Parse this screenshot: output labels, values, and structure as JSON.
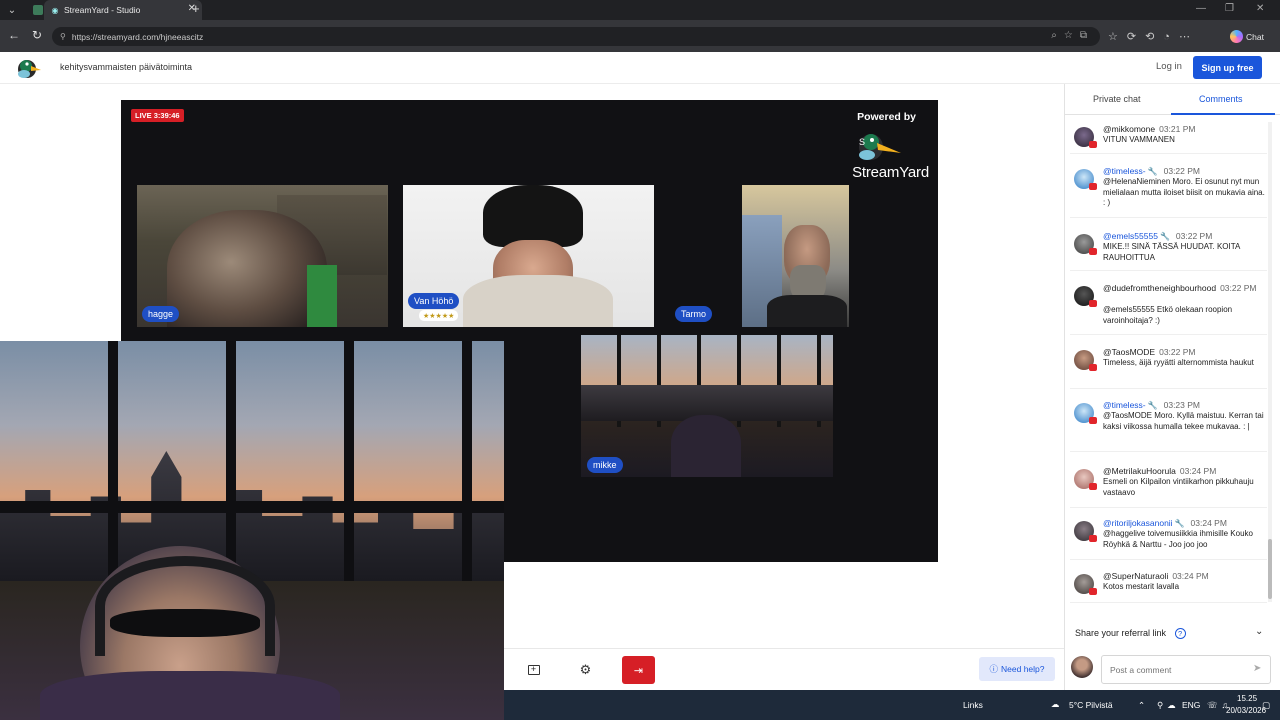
{
  "browser": {
    "tab_title": "StreamYard - Studio",
    "tab_close": "✕",
    "new_tab": "+",
    "url": "https://streamyard.com/hjneeascitz",
    "chat_label": "Chat",
    "window_controls": [
      "—",
      "❐",
      "✕"
    ]
  },
  "header": {
    "studio_title": "kehitysvammaisten päivätoiminta",
    "login_label": "Log in",
    "signup_label": "Sign up free"
  },
  "stage": {
    "live_badge": "LIVE 3:39:46",
    "powered_by": "Powered by",
    "brand": "StreamYard",
    "participants": [
      {
        "name": "hagge"
      },
      {
        "name": "Van Höhö",
        "stars": "★★★★★"
      },
      {
        "name": "Tarmo"
      },
      {
        "name": "mikke"
      }
    ]
  },
  "controls": {
    "need_help": "Need help?",
    "buttons": [
      "add-source",
      "settings",
      "leave"
    ]
  },
  "panel": {
    "tabs": [
      "Private chat",
      "Comments"
    ],
    "active_tab": "Comments",
    "comments": [
      {
        "name": "@mikkomone",
        "time": "03:21 PM",
        "text": "VITUN VAMMANEN",
        "mod": false
      },
      {
        "name": "@timeless-",
        "time": "03:22 PM",
        "text": "@HelenaNieminen Moro. Ei osunut nyt mun mielialaan mutta iloiset biisit on mukavia aina. : )",
        "mod": true
      },
      {
        "name": "@emels55555",
        "time": "03:22 PM",
        "text": "MIKE.!! SINÄ TÄSSÄ HUUDAT. KOITA RAUHOITTUA",
        "mod": true
      },
      {
        "name": "@dudefromtheneighbourhood",
        "time": "03:22 PM",
        "text": "@emels55555 Etkö olekaan roopion varoinhoitaja? :)",
        "mod": false
      },
      {
        "name": "@TaosMODE",
        "time": "03:22 PM",
        "text": "Timeless, äijä ryyätti alternommista haukut",
        "mod": false
      },
      {
        "name": "@timeless-",
        "time": "03:23 PM",
        "text": "@TaosMODE Moro. Kyllä maistuu. Kerran tai kaksi viikossa humalla tekee mukavaa. : |",
        "mod": true
      },
      {
        "name": "@MetrilakuHoorula",
        "time": "03:24 PM",
        "text": "Esmeli on Kilpailon vintiikarhon pikkuhauju vastaavo",
        "mod": false
      },
      {
        "name": "@ritoriljokasanonii",
        "time": "03:24 PM",
        "text": "@haggelive toivemusiikkia ihmisille Kouko Röyhkä & Narttu - Joo joo joo",
        "mod": true
      },
      {
        "name": "@SuperNaturaoli",
        "time": "03:24 PM",
        "text": "Kotos mestarit lavalla",
        "mod": false
      }
    ],
    "referral": "Share your referral link",
    "referral_help": "?",
    "referral_chevron": "⌄",
    "post_placeholder": "Post a comment"
  },
  "taskbar": {
    "links": "Links",
    "weather": "5°C Pilvistä",
    "lang": "ENG",
    "time": "15.25",
    "date": "20/03/2026"
  },
  "colors": {
    "accent": "#1a56db",
    "live_red": "#d61f26",
    "leave_red": "#d61f26",
    "stage_bg": "#111114"
  }
}
